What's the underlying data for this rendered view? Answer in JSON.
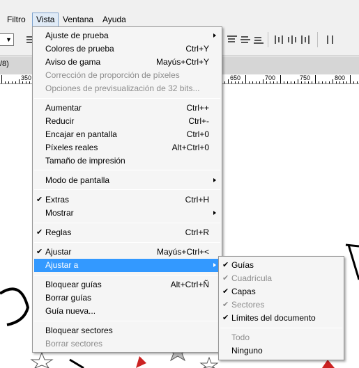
{
  "menubar": {
    "items": [
      "Filtro",
      "Vista",
      "Ventana",
      "Ayuda"
    ]
  },
  "tab": {
    "label": "/8)"
  },
  "ruler": {
    "labels": [
      "350",
      "650",
      "700",
      "750",
      "800"
    ]
  },
  "vista_menu": {
    "items": [
      {
        "label": "Ajuste de prueba",
        "shortcut": "",
        "submenu": true
      },
      {
        "label": "Colores de prueba",
        "shortcut": "Ctrl+Y"
      },
      {
        "label": "Aviso de gama",
        "shortcut": "Mayús+Ctrl+Y"
      },
      {
        "label": "Corrección de proporción de píxeles",
        "shortcut": "",
        "disabled": true
      },
      {
        "label": "Opciones de previsualización de 32 bits...",
        "shortcut": "",
        "disabled": true
      },
      {
        "label": "Aumentar",
        "shortcut": "Ctrl++"
      },
      {
        "label": "Reducir",
        "shortcut": "Ctrl+-"
      },
      {
        "label": "Encajar en pantalla",
        "shortcut": "Ctrl+0"
      },
      {
        "label": "Píxeles reales",
        "shortcut": "Alt+Ctrl+0"
      },
      {
        "label": "Tamaño de impresión",
        "shortcut": ""
      },
      {
        "label": "Modo de pantalla",
        "shortcut": "",
        "submenu": true
      },
      {
        "label": "Extras",
        "shortcut": "Ctrl+H",
        "checked": true
      },
      {
        "label": "Mostrar",
        "shortcut": "",
        "submenu": true
      },
      {
        "label": "Reglas",
        "shortcut": "Ctrl+R",
        "checked": true
      },
      {
        "label": "Ajustar",
        "shortcut": "Mayús+Ctrl+<",
        "checked": true
      },
      {
        "label": "Ajustar a",
        "shortcut": "",
        "submenu": true,
        "highlighted": true
      },
      {
        "label": "Bloquear guías",
        "shortcut": "Alt+Ctrl+Ñ"
      },
      {
        "label": "Borrar guías",
        "shortcut": ""
      },
      {
        "label": "Guía nueva...",
        "shortcut": ""
      },
      {
        "label": "Bloquear sectores",
        "shortcut": ""
      },
      {
        "label": "Borrar sectores",
        "shortcut": "",
        "disabled": true
      }
    ]
  },
  "ajustar_a_menu": {
    "items": [
      {
        "label": "Guías",
        "checked": true
      },
      {
        "label": "Cuadrícula",
        "checked": true,
        "disabled": true
      },
      {
        "label": "Capas",
        "checked": true
      },
      {
        "label": "Sectores",
        "checked": true,
        "disabled": true
      },
      {
        "label": "Límites del documento",
        "checked": true
      },
      {
        "label": "Todo",
        "disabled": true
      },
      {
        "label": "Ninguno"
      }
    ]
  },
  "colors": {
    "highlight": "#3399ff",
    "disabled_text": "#8d8d8d",
    "menu_bg": "#f5f5f5"
  },
  "icons": {
    "check": "✔",
    "submenu": "triangle-right"
  }
}
